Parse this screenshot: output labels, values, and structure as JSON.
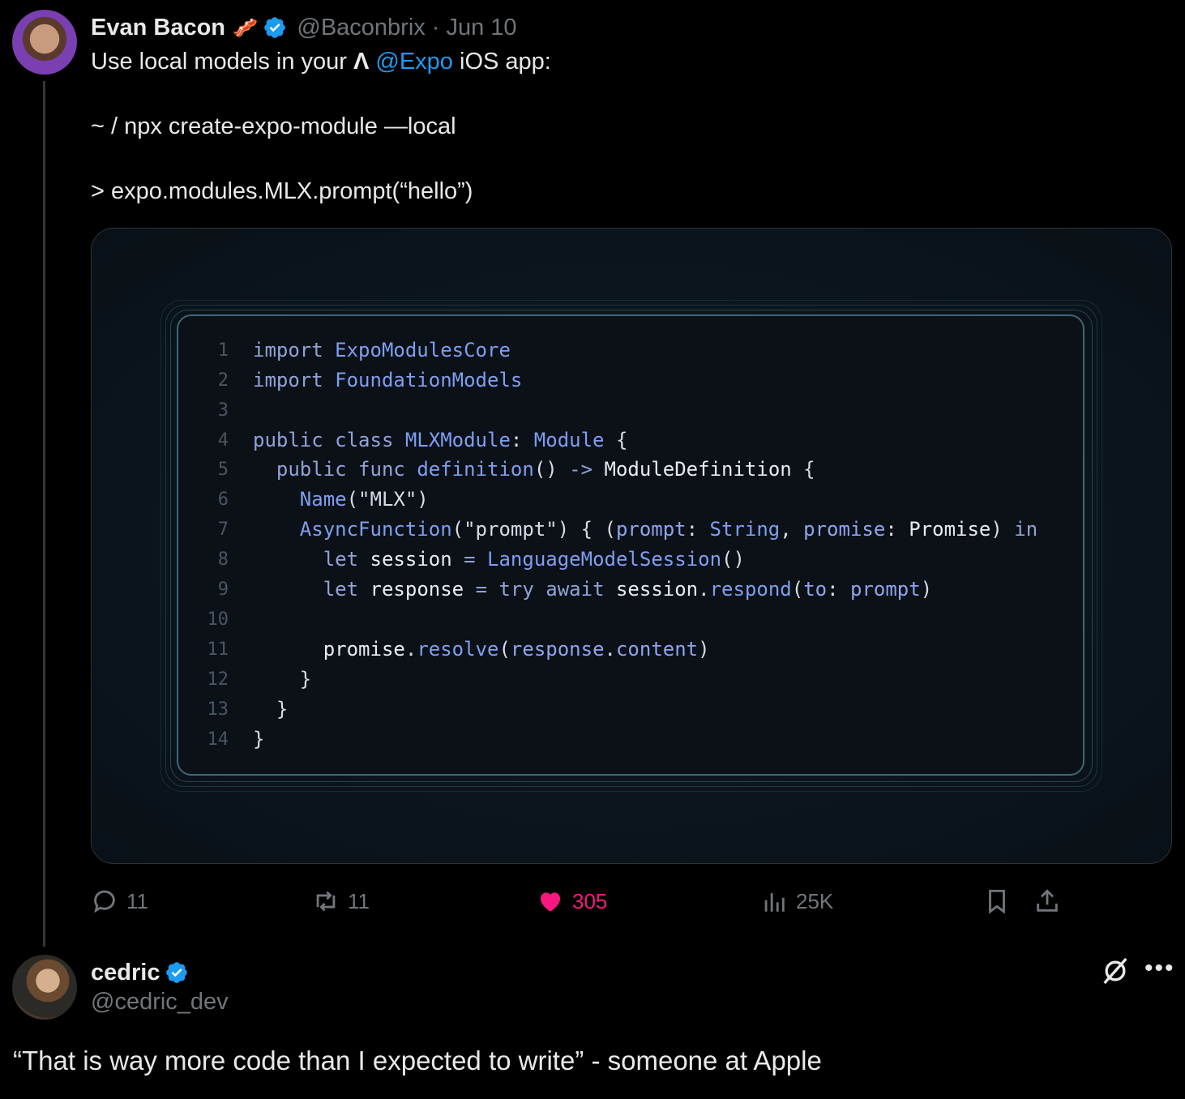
{
  "tweet": {
    "author_name": "Evan Bacon",
    "emoji": "🥓",
    "handle": "@Baconbrix",
    "separator": "·",
    "date": "Jun 10",
    "line1_pre": "Use local models in your ",
    "line1_logo": "Λ",
    "line1_mention": "@Expo",
    "line1_post": " iOS app:",
    "line2": "~ / npx create-expo-module —local",
    "line3": "> expo.modules.MLX.prompt(“hello”)"
  },
  "code": {
    "line_numbers": [
      "1",
      "2",
      "3",
      "4",
      "5",
      "6",
      "7",
      "8",
      "9",
      "10",
      "11",
      "12",
      "13",
      "14"
    ]
  },
  "actions": {
    "replies": "11",
    "retweets": "11",
    "likes": "305",
    "views": "25K"
  },
  "reply": {
    "author_name": "cedric",
    "handle": "@cedric_dev",
    "text": "“That is way more code than I expected to write” - someone at Apple"
  },
  "colors": {
    "accent": "#1d9bf0",
    "like": "#f91880",
    "muted": "#71767b"
  }
}
